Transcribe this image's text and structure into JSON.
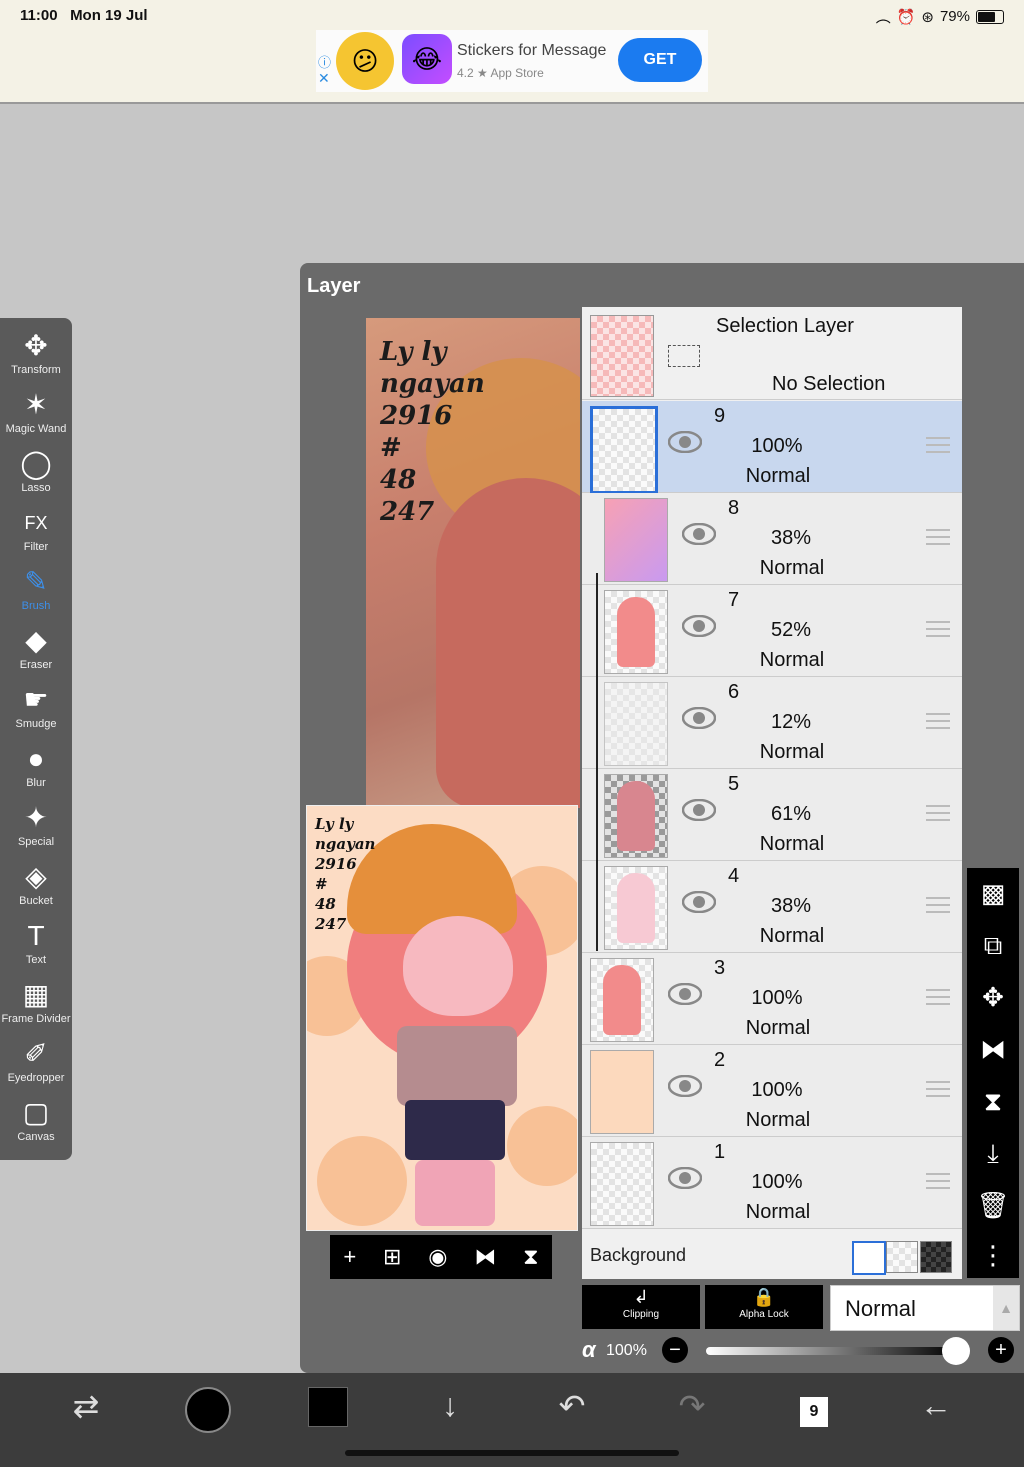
{
  "status": {
    "time": "11:00",
    "date": "Mon 19 Jul",
    "battery": "79%",
    "battery_level": 0.79
  },
  "ad": {
    "title": "Stickers for Message",
    "subtitle": "4.2 ★ App Store",
    "cta": "GET"
  },
  "tools": [
    {
      "label": "Transform",
      "icon": "✥",
      "name": "transform"
    },
    {
      "label": "Magic Wand",
      "icon": "✶",
      "name": "magic-wand"
    },
    {
      "label": "Lasso",
      "icon": "◯",
      "name": "lasso"
    },
    {
      "label": "Filter",
      "icon": "FX",
      "name": "filter"
    },
    {
      "label": "Brush",
      "icon": "✎",
      "name": "brush",
      "active": true
    },
    {
      "label": "Eraser",
      "icon": "◆",
      "name": "eraser"
    },
    {
      "label": "Smudge",
      "icon": "☛",
      "name": "smudge"
    },
    {
      "label": "Blur",
      "icon": "●",
      "name": "blur"
    },
    {
      "label": "Special",
      "icon": "✦",
      "name": "special"
    },
    {
      "label": "Bucket",
      "icon": "◈",
      "name": "bucket"
    },
    {
      "label": "Text",
      "icon": "T",
      "name": "text"
    },
    {
      "label": "Frame Divider",
      "icon": "▦",
      "name": "frame-divider"
    },
    {
      "label": "Eyedropper",
      "icon": "✐",
      "name": "eyedropper"
    },
    {
      "label": "Canvas",
      "icon": "▢",
      "name": "canvas"
    }
  ],
  "panel": {
    "title": "Layer"
  },
  "artwork": {
    "scribble_lines": [
      "Ly ly",
      "ngayan",
      "2916",
      "#",
      "48",
      "247"
    ]
  },
  "selection_layer": {
    "title": "Selection Layer",
    "status": "No Selection"
  },
  "layers": [
    {
      "number": "9",
      "opacity": "100%",
      "blend": "Normal",
      "selected": true,
      "thumb": "blank",
      "indent": false
    },
    {
      "number": "8",
      "opacity": "38%",
      "blend": "Normal",
      "thumb": "gradient",
      "indent": true
    },
    {
      "number": "7",
      "opacity": "52%",
      "blend": "Normal",
      "thumb": "character",
      "indent": true
    },
    {
      "number": "6",
      "opacity": "12%",
      "blend": "Normal",
      "thumb": "faint",
      "indent": true
    },
    {
      "number": "5",
      "opacity": "61%",
      "blend": "Normal",
      "thumb": "character-dark",
      "indent": true
    },
    {
      "number": "4",
      "opacity": "38%",
      "blend": "Normal",
      "thumb": "character-light",
      "indent": true
    },
    {
      "number": "3",
      "opacity": "100%",
      "blend": "Normal",
      "thumb": "character",
      "indent": false
    },
    {
      "number": "2",
      "opacity": "100%",
      "blend": "Normal",
      "thumb": "peach",
      "indent": false
    },
    {
      "number": "1",
      "opacity": "100%",
      "blend": "Normal",
      "thumb": "blank",
      "indent": false
    }
  ],
  "background": {
    "label": "Background"
  },
  "blend_controls": {
    "clipping": "Clipping",
    "alpha_lock": "Alpha Lock",
    "blend_mode": "Normal"
  },
  "alpha": {
    "symbol": "α",
    "value": "100%",
    "level": 1.0
  },
  "bottom": {
    "layer_count": "9"
  },
  "colors": {
    "accent": "#3d8fe8",
    "selected_row": "#c8d7ee",
    "toolbar": "#5a5a5a"
  }
}
